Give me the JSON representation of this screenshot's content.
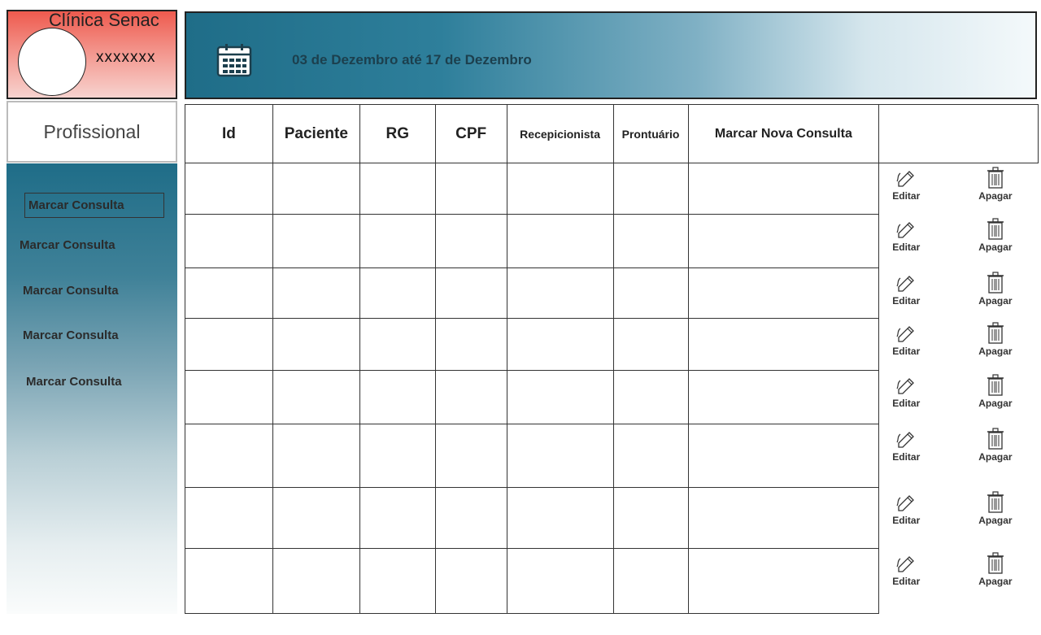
{
  "brand": {
    "title": "Clínica Senac",
    "user": "xxxxxxx"
  },
  "header": {
    "date_range": "03 de Dezembro até 17 de Dezembro",
    "icon": "calendar-icon"
  },
  "profile_box": {
    "label": "Profissional"
  },
  "sidebar": {
    "items": [
      {
        "label": "Marcar Consulta"
      },
      {
        "label": "Marcar Consulta"
      },
      {
        "label": "Marcar Consulta"
      },
      {
        "label": "Marcar Consulta"
      },
      {
        "label": "Marcar Consulta"
      }
    ]
  },
  "table": {
    "columns": [
      "Id",
      "Paciente",
      "RG",
      "CPF",
      "Recepicionista",
      "Prontuário",
      "Marcar Nova Consulta",
      ""
    ],
    "row_count": 8,
    "actions": {
      "edit_label": "Editar",
      "delete_label": "Apagar",
      "edit_icon": "pencil-icon",
      "delete_icon": "trash-icon"
    }
  }
}
